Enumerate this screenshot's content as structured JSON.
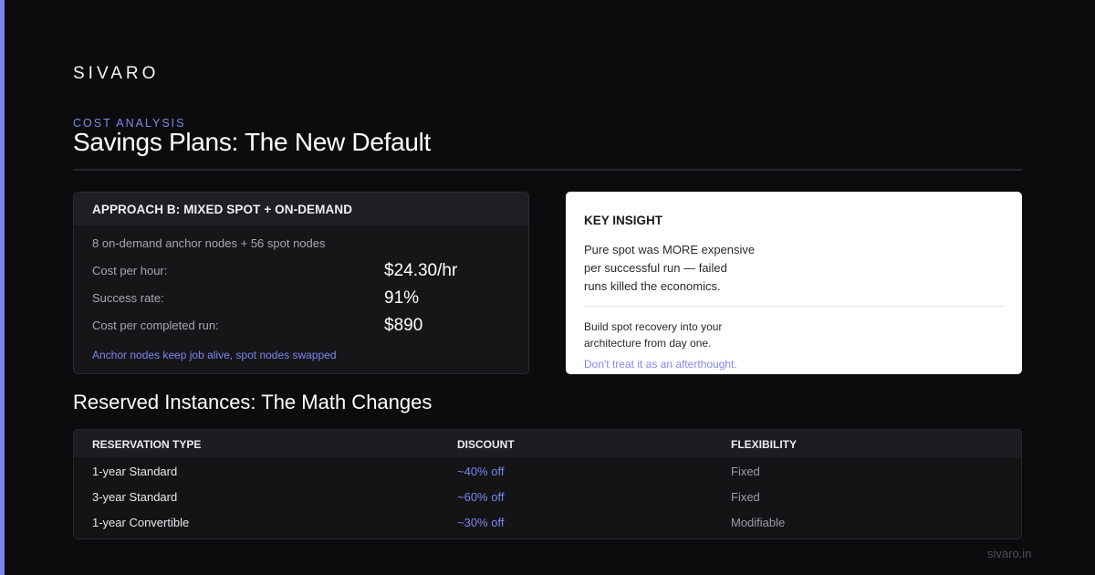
{
  "brand": "SIVARO",
  "eyebrow": "COST ANALYSIS",
  "title": "Savings Plans: The New Default",
  "approach_card": {
    "header": "APPROACH B: MIXED SPOT + ON-DEMAND",
    "subtitle": "8 on-demand anchor nodes + 56 spot nodes",
    "metrics": [
      {
        "label": "Cost per hour:",
        "value": "$24.30/hr"
      },
      {
        "label": "Success rate:",
        "value": "91%"
      },
      {
        "label": "Cost per completed run:",
        "value": "$890"
      }
    ],
    "note": "Anchor nodes keep job alive, spot nodes swapped"
  },
  "insight_card": {
    "title": "KEY INSIGHT",
    "body": [
      "Pure spot was MORE expensive",
      "per successful run — failed",
      "runs killed the economics."
    ],
    "body2": [
      "Build spot recovery into your",
      "architecture from day one."
    ],
    "note": "Don't treat it as an afterthought."
  },
  "reserved_section": {
    "title": "Reserved Instances: The Math Changes",
    "columns": [
      "RESERVATION TYPE",
      "DISCOUNT",
      "FLEXIBILITY"
    ],
    "rows": [
      {
        "type": "1-year Standard",
        "discount": "~40% off",
        "flexibility": "Fixed"
      },
      {
        "type": "3-year Standard",
        "discount": "~60% off",
        "flexibility": "Fixed"
      },
      {
        "type": "1-year Convertible",
        "discount": "~30% off",
        "flexibility": "Modifiable"
      }
    ]
  },
  "footer": "sivaro.in",
  "colors": {
    "accent": "#7b85f0",
    "background": "#0c0c0e",
    "card": "#161619"
  }
}
